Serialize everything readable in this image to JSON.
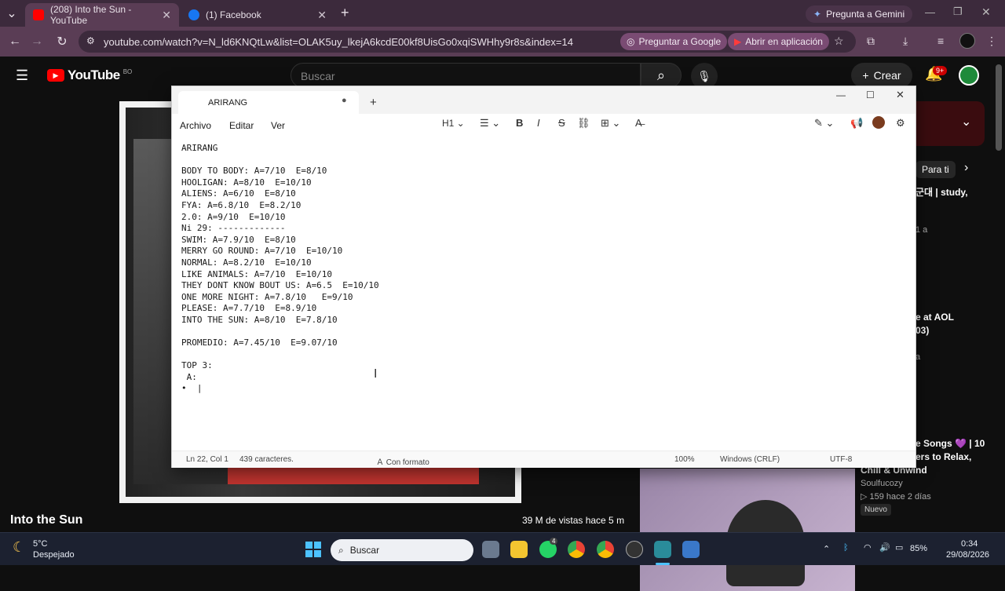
{
  "browser": {
    "tabs": [
      {
        "label": "(208) Into the Sun - YouTube",
        "icon": "youtube-icon"
      },
      {
        "label": "(1) Facebook",
        "icon": "facebook-icon"
      }
    ],
    "gemini_label": "Pregunta a Gemini",
    "url": "youtube.com/watch?v=N_ld6KNQtLw&list=OLAK5uy_lkejA6kcdE00kf8UisGo0xqiSWHhy9r8s&index=14",
    "ask_google": "Preguntar a Google",
    "open_app": "Abrir en aplicación"
  },
  "youtube": {
    "logo": "YouTube",
    "country": "BO",
    "search_placeholder": "Buscar",
    "create_label": "Crear",
    "notif_count": "9+",
    "video_title": "Into the Sun",
    "video_meta": "39 M de vistas  hace 5 m",
    "sidebar": {
      "chip": "Para ti",
      "r1": "군대 | study,",
      "r1b": "1 a",
      "r2": "e at AOL",
      "r2b": "03)",
      "r2c": "a",
      "r3a": "e Songs 💜 | 10",
      "r3b": "ers to Relax,",
      "r3c": "Chill & Unwind",
      "channel": "Soulfucozy",
      "stats": "▷ 159  hace 2 días",
      "badge": "Nuevo"
    }
  },
  "notepad": {
    "tab_title": "ARIRANG",
    "menu": [
      "Archivo",
      "Editar",
      "Ver"
    ],
    "heading_label": "H1",
    "content": "ARIRANG\n\nBODY TO BODY: A=7/10  E=8/10\nHOOLIGAN: A=8/10  E=10/10\nALIENS: A=6/10  E=8/10\nFYA: A=6.8/10  E=8.2/10\n2.0: A=9/10  E=10/10\nNi 29: -------------\nSWIM: A=7.9/10  E=8/10\nMERRY GO ROUND: A=7/10  E=10/10\nNORMAL: A=8.2/10  E=10/10\nLIKE ANIMALS: A=7/10  E=10/10\nTHEY DONT KNOW BOUT US: A=6.5  E=10/10\nONE MORE NIGHT: A=7.8/10   E=9/10\nPLEASE: A=7.7/10  E=8.9/10\nINTO THE SUN: A=8/10  E=7.8/10\n\nPROMEDIO: A=7.45/10  E=9.07/10\n\nTOP 3:\n A:\n•  |",
    "status": {
      "position": "Ln 22, Col 1",
      "chars": "439 caracteres.",
      "format": "Con formato",
      "zoom": "100%",
      "eol": "Windows (CRLF)",
      "encoding": "UTF-8"
    }
  },
  "taskbar": {
    "weather_temp": "5°C",
    "weather_desc": "Despejado",
    "search": "Buscar",
    "battery": "85%",
    "time": "0:34",
    "date": "29/08/2026",
    "whatsapp_badge": "4"
  },
  "colors": {
    "chrome_dark": "#3c2a3c",
    "chrome_mid": "#5a3d55",
    "youtube_red": "#ff0000",
    "yt_bg": "#0f0f0f"
  }
}
